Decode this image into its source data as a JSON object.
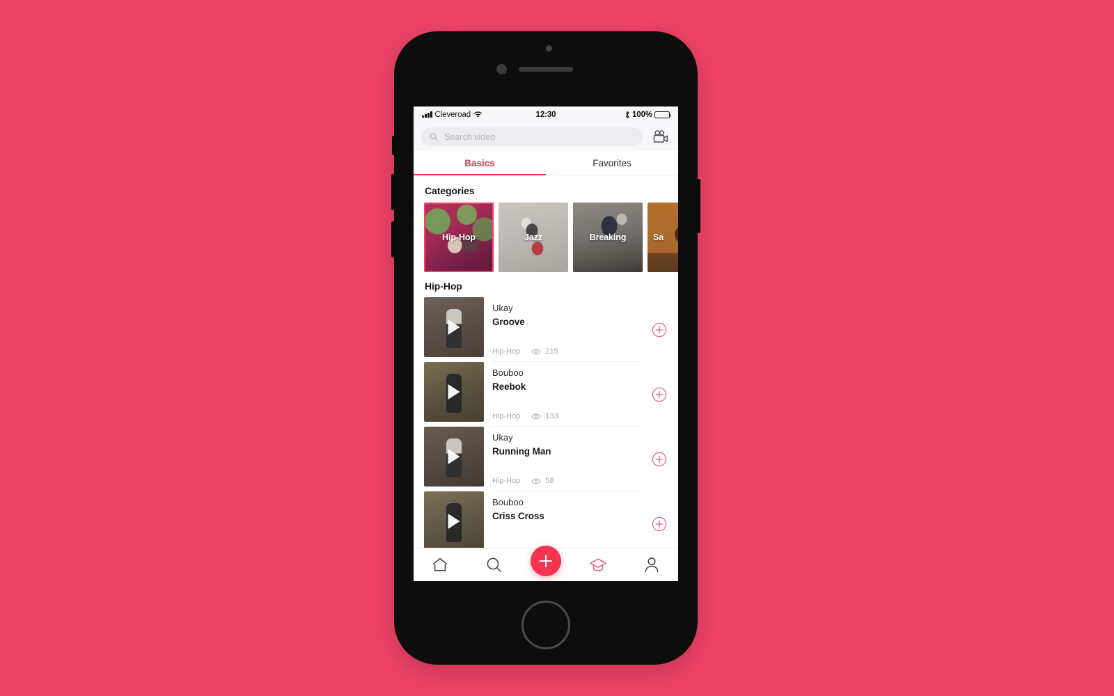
{
  "background_color": "#ee4366",
  "accent_color": "#e8344f",
  "fab_color": "#f7344f",
  "status_bar": {
    "carrier": "Cleveroad",
    "time": "12:30",
    "battery_percent": "100%",
    "signal_icon": "signal-bars-icon",
    "wifi_icon": "wifi-icon",
    "bluetooth_icon": "bluetooth-icon",
    "battery_icon": "battery-full-icon"
  },
  "header": {
    "search_placeholder": "Search video",
    "search_value": "",
    "search_icon": "search-icon",
    "camera_button_icon": "video-camera-icon"
  },
  "tabs": [
    {
      "label": "Basics",
      "active": true
    },
    {
      "label": "Favorites",
      "active": false
    }
  ],
  "categories_section": {
    "title": "Categories",
    "items": [
      {
        "label": "Hip-Hop",
        "selected": true,
        "theme": "ph-hiphop"
      },
      {
        "label": "Jazz",
        "selected": false,
        "theme": "ph-jazz"
      },
      {
        "label": "Breaking",
        "selected": false,
        "theme": "ph-breaking"
      },
      {
        "label": "Sa",
        "selected": false,
        "theme": "ph-salsa"
      }
    ]
  },
  "videos_section": {
    "title": "Hip-Hop",
    "add_icon": "circle-plus-icon",
    "views_icon": "eye-icon",
    "play_icon": "play-icon",
    "items": [
      {
        "author": "Ukay",
        "title": "Groove",
        "category": "Hip-Hop",
        "views": "215",
        "thumb": "th-a"
      },
      {
        "author": "Bouboo",
        "title": "Reebok",
        "category": "Hip-Hop",
        "views": "133",
        "thumb": "th-b"
      },
      {
        "author": "Ukay",
        "title": "Running Man",
        "category": "Hip-Hop",
        "views": "58",
        "thumb": "th-c"
      },
      {
        "author": "Bouboo",
        "title": "Criss Cross",
        "category": "",
        "views": "",
        "thumb": "th-d"
      }
    ]
  },
  "bottom_nav": [
    {
      "name": "home",
      "icon": "home-icon",
      "active": false
    },
    {
      "name": "search",
      "icon": "search-icon",
      "active": false
    },
    {
      "name": "create",
      "icon": "plus-icon",
      "active": true
    },
    {
      "name": "learn",
      "icon": "graduation-cap-icon",
      "active": true
    },
    {
      "name": "profile",
      "icon": "person-icon",
      "active": false
    }
  ]
}
